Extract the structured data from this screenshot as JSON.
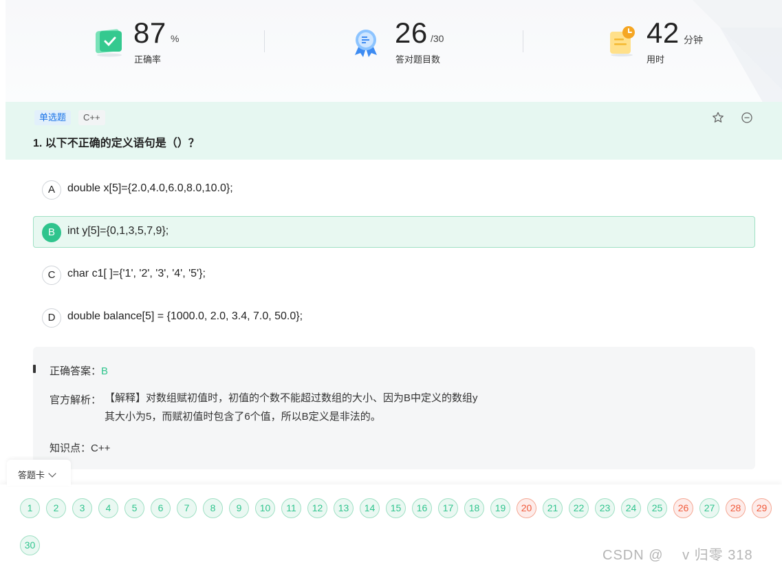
{
  "stats": {
    "accuracy": {
      "value": "87",
      "unit": "%",
      "label": "正确率"
    },
    "correct": {
      "value": "26",
      "unit": "/30",
      "label": "答对题目数"
    },
    "time": {
      "value": "42",
      "unit": "分钟",
      "label": "用时"
    }
  },
  "question": {
    "type_tag": "单选题",
    "lang_tag": "C++",
    "title": "1. 以下不正确的定义语句是（）？",
    "favorite_icon": "star-outline-icon",
    "remove_icon": "minus-circle-icon"
  },
  "options": [
    {
      "letter": "A",
      "text": "double x[5]={2.0,4.0,6.0,8.0,10.0};",
      "selected": false
    },
    {
      "letter": "B",
      "text": "int y[5]={0,1,3,5,7,9};",
      "selected": true
    },
    {
      "letter": "C",
      "text": "char c1[ ]={'1', '2', '3', '4', '5'};",
      "selected": false
    },
    {
      "letter": "D",
      "text": "double balance[5] = {1000.0, 2.0, 3.4, 7.0, 50.0};",
      "selected": false
    }
  ],
  "analysis": {
    "answer_label": "正确答案：",
    "answer_value": "B",
    "explain_label": "官方解析：",
    "explain_line1": "【解释】对数组赋初值时，初值的个数不能超过数组的大小、因为B中定义的数组y",
    "explain_line2": "其大小为5，而赋初值时包含了6个值，所以B定义是非法的。",
    "knowledge_label": "知识点：",
    "knowledge_value": "C++"
  },
  "answer_card": {
    "tab_label": "答题卡",
    "questions": [
      {
        "n": "1",
        "status": "correct"
      },
      {
        "n": "2",
        "status": "correct"
      },
      {
        "n": "3",
        "status": "correct"
      },
      {
        "n": "4",
        "status": "correct"
      },
      {
        "n": "5",
        "status": "correct"
      },
      {
        "n": "6",
        "status": "correct"
      },
      {
        "n": "7",
        "status": "correct"
      },
      {
        "n": "8",
        "status": "correct"
      },
      {
        "n": "9",
        "status": "correct"
      },
      {
        "n": "10",
        "status": "correct"
      },
      {
        "n": "11",
        "status": "correct"
      },
      {
        "n": "12",
        "status": "correct"
      },
      {
        "n": "13",
        "status": "correct"
      },
      {
        "n": "14",
        "status": "correct"
      },
      {
        "n": "15",
        "status": "correct"
      },
      {
        "n": "16",
        "status": "correct"
      },
      {
        "n": "17",
        "status": "correct"
      },
      {
        "n": "18",
        "status": "correct"
      },
      {
        "n": "19",
        "status": "correct"
      },
      {
        "n": "20",
        "status": "wrong"
      },
      {
        "n": "21",
        "status": "correct"
      },
      {
        "n": "22",
        "status": "correct"
      },
      {
        "n": "23",
        "status": "correct"
      },
      {
        "n": "24",
        "status": "correct"
      },
      {
        "n": "25",
        "status": "correct"
      },
      {
        "n": "26",
        "status": "wrong"
      },
      {
        "n": "27",
        "status": "correct"
      },
      {
        "n": "28",
        "status": "wrong"
      },
      {
        "n": "29",
        "status": "wrong"
      },
      {
        "n": "30",
        "status": "correct"
      }
    ]
  },
  "watermark": "CSDN @ 　v 归零 318",
  "colors": {
    "accent": "#2fc48d",
    "wrong": "#f0593a",
    "header_bg": "#e6f7f1"
  }
}
